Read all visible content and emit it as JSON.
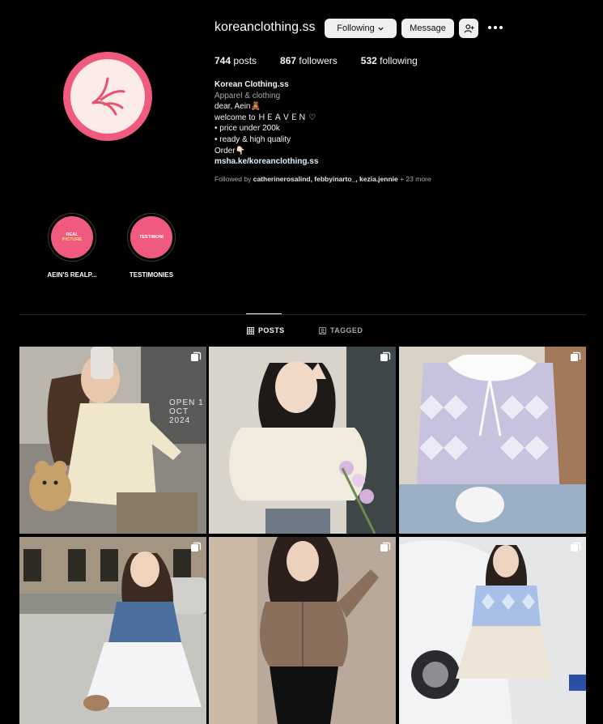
{
  "profile": {
    "username": "koreanclothing.ss",
    "following_btn": "Following",
    "message_btn": "Message",
    "stats": {
      "posts_num": "744",
      "posts_label": " posts",
      "followers_num": "867",
      "followers_label": " followers",
      "following_num": "532",
      "following_label": " following"
    },
    "bio": {
      "name": "Korean Clothing.ss",
      "category": "Apparel & clothing",
      "line1": "dear, Aein🧸",
      "line2": "welcome to ＨＥＡＶＥＮ ♡",
      "line3": "• price under 200k",
      "line4": "• ready & high quality",
      "line5": "Order👇🏻",
      "link": "msha.ke/koreanclothing.ss"
    },
    "followed_by": {
      "prefix": "Followed by ",
      "names": "catherinerosalind, febbyinarto_, kezia.jennie",
      "suffix": " + 23 more"
    }
  },
  "highlights": [
    {
      "label": "AEIN'S REALP...",
      "cover_line1": "REAL",
      "cover_line2": "PICTURE"
    },
    {
      "label": "TESTIMONIES",
      "cover_line1": "TESTIMONI",
      "cover_line2": ""
    }
  ],
  "tabs": {
    "posts": "POSTS",
    "tagged": "TAGGED"
  },
  "posts": [
    {
      "desc": "cream ruffle cardigan with teddy bear",
      "overlay": "OPEN 1 OCT 2024"
    },
    {
      "desc": "cream cable knit puff sleeve top"
    },
    {
      "desc": "lavender argyle cardigan with lace collar"
    },
    {
      "desc": "denim corset puff sleeve white dress"
    },
    {
      "desc": "brown hooded zip cardigan"
    },
    {
      "desc": "blue argyle knit polo with pleated skirt"
    }
  ],
  "colors": {
    "accent": "#f05a7e",
    "background": "#000000"
  }
}
